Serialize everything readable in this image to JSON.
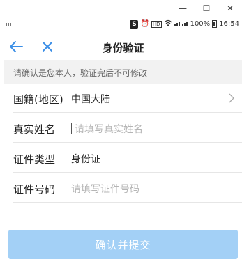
{
  "window": {
    "minimize_glyph": "—",
    "maximize_glyph": "☐",
    "close_glyph": "✕"
  },
  "statusbar": {
    "app_letter": "S",
    "hd": "HD",
    "battery": "100%",
    "time": "16:54"
  },
  "nav": {
    "title": "身份验证",
    "back_icon": "arrow-left-icon",
    "close_icon": "close-icon",
    "accent": "#3a8ee6"
  },
  "notice": "请确认是您本人，验证完后不可修改",
  "form": {
    "nationality": {
      "label": "国籍(地区)",
      "value": "中国大陆"
    },
    "name": {
      "label": "真实姓名",
      "placeholder": "请填写真实姓名"
    },
    "id_type": {
      "label": "证件类型",
      "value": "身份证"
    },
    "id_number": {
      "label": "证件号码",
      "placeholder": "请填写证件号码"
    }
  },
  "submit": {
    "label": "确认并提交",
    "color": "#a3d0f6"
  }
}
